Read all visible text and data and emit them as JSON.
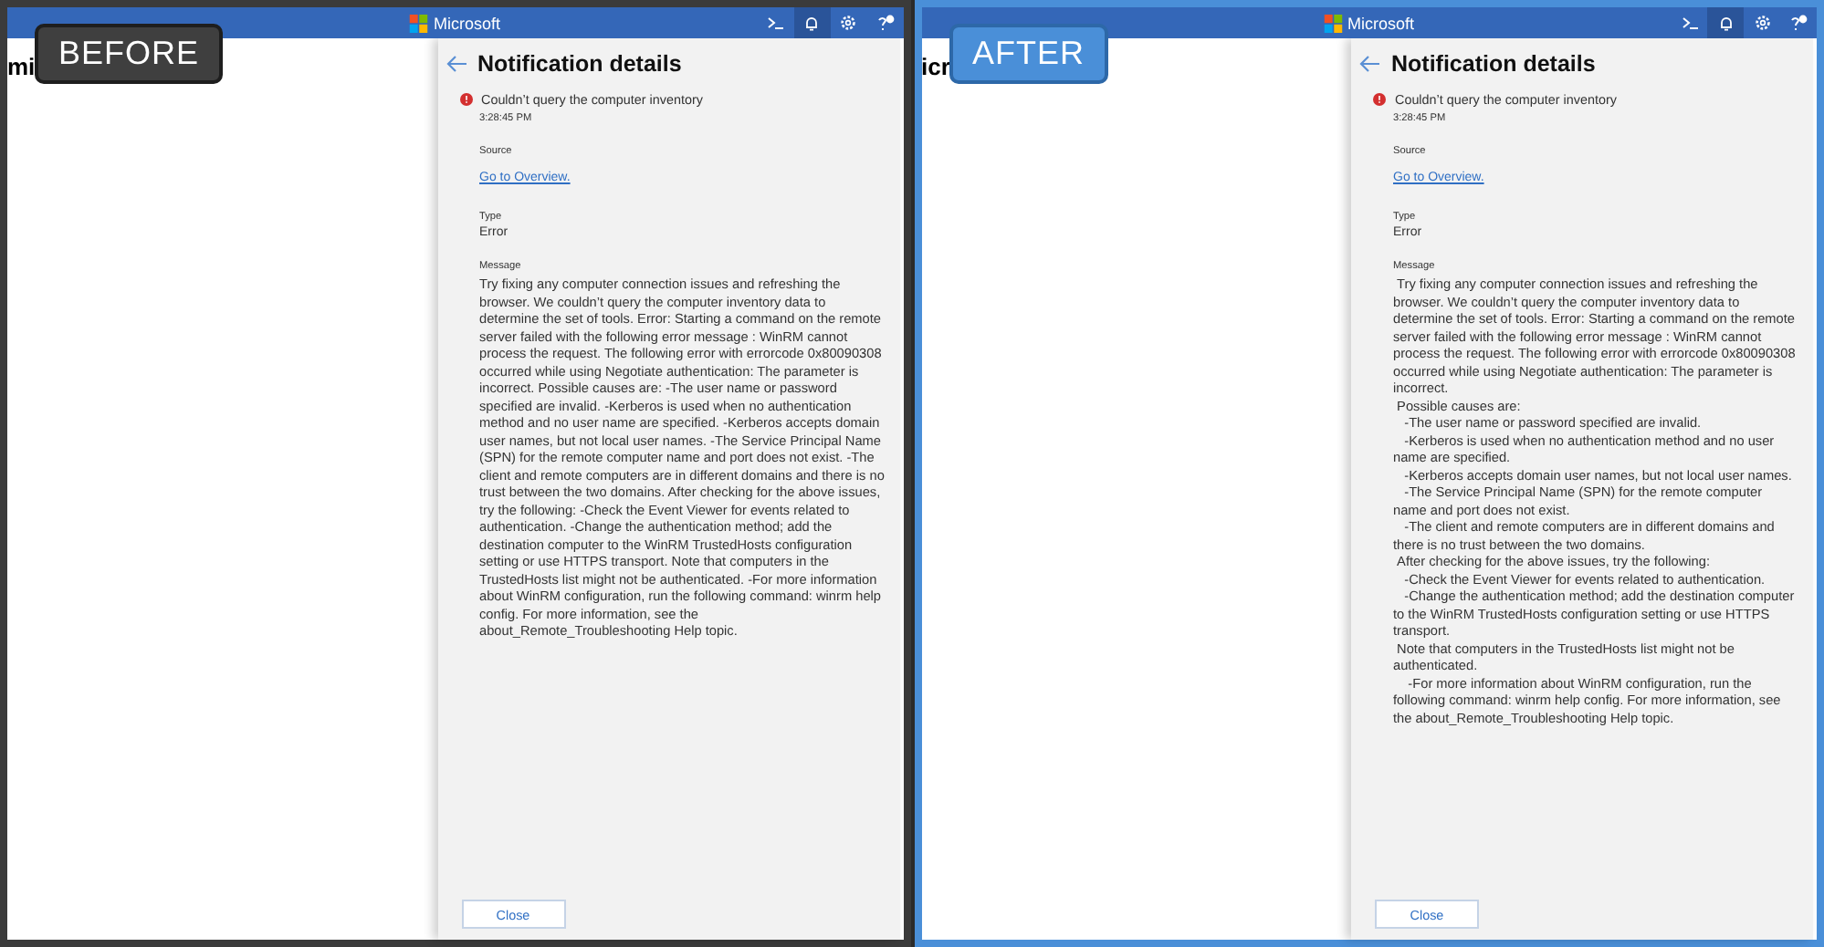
{
  "panels": [
    {
      "label": "BEFORE",
      "kind": "dark",
      "brand": "Microsoft",
      "page_title": "mi",
      "notification": {
        "title": "Notification details",
        "summary": "Couldn’t query the computer inventory",
        "time": "3:28:45 PM",
        "source_label": "Source",
        "source_link": "Go to Overview.",
        "type_label": "Type",
        "type_value": "Error",
        "message_label": "Message",
        "message_lines": [
          "Try fixing any computer connection issues and refreshing the browser. We couldn’t query the computer inventory data to determine the set of tools. Error: Starting a command on the remote server failed with the following error message : WinRM cannot process the request. The following error with errorcode 0x80090308 occurred while using Negotiate authentication: The parameter is incorrect. Possible causes are: -The user name or password specified are invalid. -Kerberos is used when no authentication method and no user name are specified. -Kerberos accepts domain user names, but not local user names. -The Service Principal Name (SPN) for the remote computer name and port does not exist. -The client and remote computers are in different domains and there is no trust between the two domains. After checking for the above issues, try the following: -Check the Event Viewer for events related to authentication. -Change the authentication method; add the destination computer to the WinRM TrustedHosts configuration setting or use HTTPS transport. Note that computers in the TrustedHosts list might not be authenticated. -For more information about WinRM configuration, run the following command: winrm help config. For more information, see the about_Remote_Troubleshooting Help topic."
        ]
      },
      "close_button": "Close"
    },
    {
      "label": "AFTER",
      "kind": "blue",
      "brand": "Microsoft",
      "page_title": "icr",
      "notification": {
        "title": "Notification details",
        "summary": "Couldn’t query the computer inventory",
        "time": "3:28:45 PM",
        "source_label": "Source",
        "source_link": "Go to Overview.",
        "type_label": "Type",
        "type_value": "Error",
        "message_label": "Message",
        "message_lines": [
          " Try fixing any computer connection issues and refreshing the browser. We couldn’t query the computer inventory data to determine the set of tools. Error: Starting a command on the remote server failed with the following error message : WinRM cannot process the request. The following error with errorcode 0x80090308 occurred while using Negotiate authentication: The parameter is incorrect.",
          " Possible causes are:",
          "   -The user name or password specified are invalid.",
          "   -Kerberos is used when no authentication method and no user name are specified.",
          "   -Kerberos accepts domain user names, but not local user names.",
          "   -The Service Principal Name (SPN) for the remote computer name and port does not exist.",
          "   -The client and remote computers are in different domains and there is no trust between the two domains.",
          " After checking for the above issues, try the following:",
          "   -Check the Event Viewer for events related to authentication.",
          "   -Change the authentication method; add the destination computer to the WinRM TrustedHosts configuration setting or use HTTPS transport.",
          " Note that computers in the TrustedHosts list might not be authenticated.",
          "    -For more information about WinRM configuration, run the following command: winrm help config. For more information, see the about_Remote_Troubleshooting Help topic."
        ]
      },
      "close_button": "Close"
    }
  ]
}
